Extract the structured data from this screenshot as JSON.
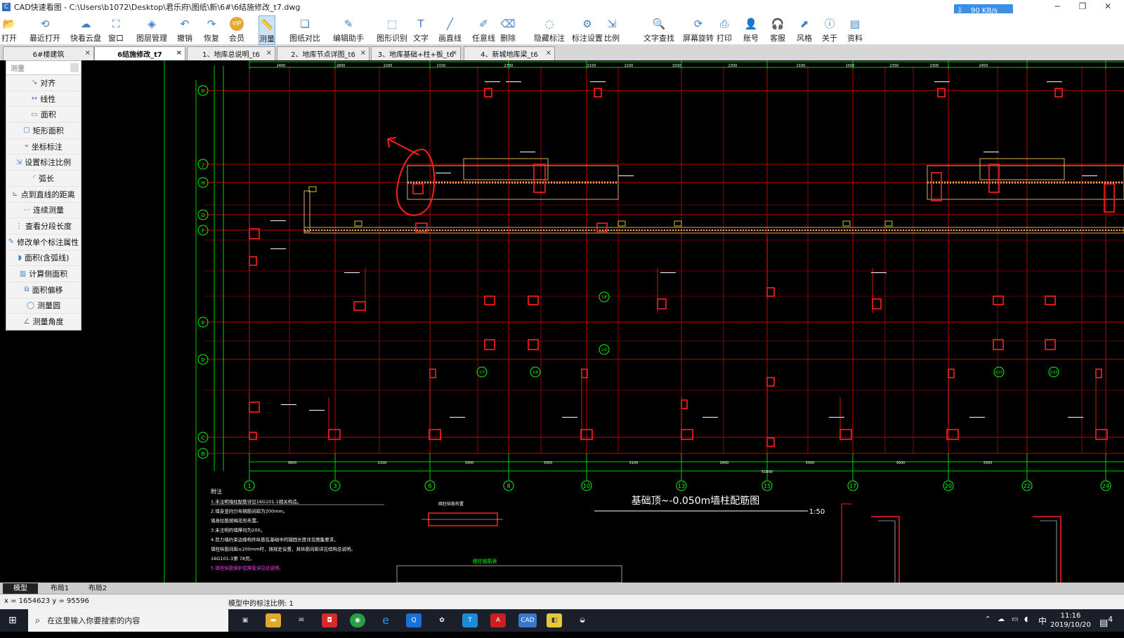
{
  "app": {
    "title": "CAD快速看图 - C:\\Users\\b1072\\Desktop\\君乐府\\图纸\\新\\6#\\6结施修改_t7.dwg",
    "net_speed": "90 KB/s",
    "window_controls": [
      "─",
      "❐",
      "✕"
    ]
  },
  "toolbar": [
    {
      "label": "打开",
      "icon": "folder-open-icon",
      "glyph": "📂"
    },
    {
      "label": "最近打开",
      "icon": "history-icon",
      "glyph": "⟲"
    },
    {
      "label": "快看云盘",
      "icon": "cloud-icon",
      "glyph": "☁"
    },
    {
      "label": "窗口",
      "icon": "window-icon",
      "glyph": "⛶"
    },
    {
      "label": "图层管理",
      "icon": "layers-icon",
      "glyph": "◈"
    },
    {
      "label": "撤销",
      "icon": "undo-icon",
      "glyph": "↶"
    },
    {
      "label": "恢复",
      "icon": "redo-icon",
      "glyph": "↷"
    },
    {
      "label": "会员",
      "icon": "vip-icon",
      "glyph": "VIP"
    },
    {
      "label": "测量",
      "icon": "measure-icon",
      "glyph": "📏"
    },
    {
      "label": "图纸对比",
      "icon": "compare-icon",
      "glyph": "❏"
    },
    {
      "label": "编辑助手",
      "icon": "edit-assistant-icon",
      "glyph": "✎"
    },
    {
      "label": "图形识别",
      "icon": "shape-recognition-icon",
      "glyph": "⬚"
    },
    {
      "label": "文字",
      "icon": "text-icon",
      "glyph": "T"
    },
    {
      "label": "画直线",
      "icon": "line-icon",
      "glyph": "╱"
    },
    {
      "label": "任意线",
      "icon": "freehand-icon",
      "glyph": "✐"
    },
    {
      "label": "删除",
      "icon": "eraser-icon",
      "glyph": "⌫"
    },
    {
      "label": "隐藏标注",
      "icon": "hide-annotation-icon",
      "glyph": "◌"
    },
    {
      "label": "标注设置",
      "icon": "annotation-settings-icon",
      "glyph": "⚙"
    },
    {
      "label": "比例",
      "icon": "scale-icon",
      "glyph": "⇲"
    },
    {
      "label": "文字查找",
      "icon": "find-text-icon",
      "glyph": "🔍"
    },
    {
      "label": "屏幕旋转",
      "icon": "rotate-icon",
      "glyph": "⟳"
    },
    {
      "label": "打印",
      "icon": "print-icon",
      "glyph": "⎙"
    },
    {
      "label": "账号",
      "icon": "account-icon",
      "glyph": "👤"
    },
    {
      "label": "客服",
      "icon": "headset-icon",
      "glyph": "🎧"
    },
    {
      "label": "风格",
      "icon": "style-icon",
      "glyph": "⬈"
    },
    {
      "label": "关于",
      "icon": "info-icon",
      "glyph": "ⓘ"
    },
    {
      "label": "资料",
      "icon": "docs-icon",
      "glyph": "▤"
    }
  ],
  "tabs": [
    {
      "label": "6#楼建筑",
      "close": "×"
    },
    {
      "label": "6结施修改_t7",
      "close": "×",
      "active": true
    },
    {
      "label": "1、地库总说明_t6",
      "close": "×"
    },
    {
      "label": "2、地库节点详图_t6",
      "close": "×"
    },
    {
      "label": "3、地库基础+柱+板_t6",
      "close": "×"
    },
    {
      "label": "4、新城地库梁_t6",
      "close": "×"
    }
  ],
  "measure_panel": {
    "header": "测量",
    "items": [
      {
        "label": "对齐",
        "glyph": "↘"
      },
      {
        "label": "线性",
        "glyph": "↔"
      },
      {
        "label": "面积",
        "glyph": "▭"
      },
      {
        "label": "矩形面积",
        "glyph": "▢"
      },
      {
        "label": "坐标标注",
        "glyph": "⌖"
      },
      {
        "label": "设置标注比例",
        "glyph": "⇲"
      },
      {
        "label": "弧长",
        "glyph": "◜"
      },
      {
        "label": "点到直线的距离",
        "glyph": "⊾"
      },
      {
        "label": "连续测量",
        "glyph": "⋯"
      },
      {
        "label": "查看分段长度",
        "glyph": "⋮"
      },
      {
        "label": "修改单个标注属性",
        "glyph": "✎"
      },
      {
        "label": "面积(含弧线)",
        "glyph": "◗"
      },
      {
        "label": "计算侧面积",
        "glyph": "▥"
      },
      {
        "label": "面积偏移",
        "glyph": "⧉"
      },
      {
        "label": "测量圆",
        "glyph": "◯"
      },
      {
        "label": "测量角度",
        "glyph": "∠"
      }
    ]
  },
  "drawing": {
    "title": "基础顶~-0.050m墙柱配筋图",
    "scale": "1:50",
    "notes_title": "附注",
    "notes": [
      "1.未注明墙柱配筋详见16G101-1相关构造。",
      "2.墙身竖向分布钢筋间距为200mm。",
      "  墙身拉筋按梅花形布置。",
      "3.未注明的墙厚均为200。",
      "4.剪力墙约束边缘构件纵筋在基础中的锚固长度详见图集要求，",
      "  墙柱纵筋间距≤200mm时，按规定设置，其纵筋间距详见结构总说明。",
      "  16G101-3第  78页。",
      "5.墙柱纵筋保护层厚度详见总说明。"
    ],
    "detail_label": "暗柱纵筋布置",
    "table_caption": "墙柱钢筋表",
    "column_axes": [
      "1",
      "3",
      "6",
      "8",
      "10",
      "13",
      "15",
      "17",
      "20",
      "22",
      "24"
    ],
    "row_axes": [
      "K",
      "J",
      "H",
      "G",
      "F",
      "E",
      "D",
      "C",
      "B"
    ],
    "sub_axes": [
      "1/E",
      "1/D",
      "1/7",
      "1/8",
      "1/21",
      "1/22"
    ],
    "top_dims": [
      "2400",
      "1800",
      "2200",
      "2150",
      "2700",
      "2150",
      "2100",
      "1500",
      "2300",
      "2100",
      "1500",
      "2350",
      "2300",
      "2450"
    ],
    "bottom_dims": [
      "3600",
      "2100",
      "3300",
      "3300",
      "3100",
      "2600",
      "3300",
      "3000",
      "3300"
    ],
    "bottom_total": "51800"
  },
  "model_tabs": [
    "模型",
    "布局1",
    "布局2"
  ],
  "status": {
    "coords": "x = 1654623  y = 95596",
    "scale_text": "模型中的标注比例: 1"
  },
  "taskbar": {
    "search_placeholder": "在这里输入你要搜索的内容",
    "ime": "中",
    "time": "11:16",
    "date": "2019/10/20",
    "notify_count": "4"
  },
  "colors": {
    "axis": "#00d000",
    "wall": "#ff2020",
    "grid_red": "#c00000",
    "text_white": "#ffffff",
    "dim_green": "#00ff00",
    "hatch": "#d8b060",
    "highlight_yellow": "#ffff00",
    "accent": "#3d8fe5"
  }
}
